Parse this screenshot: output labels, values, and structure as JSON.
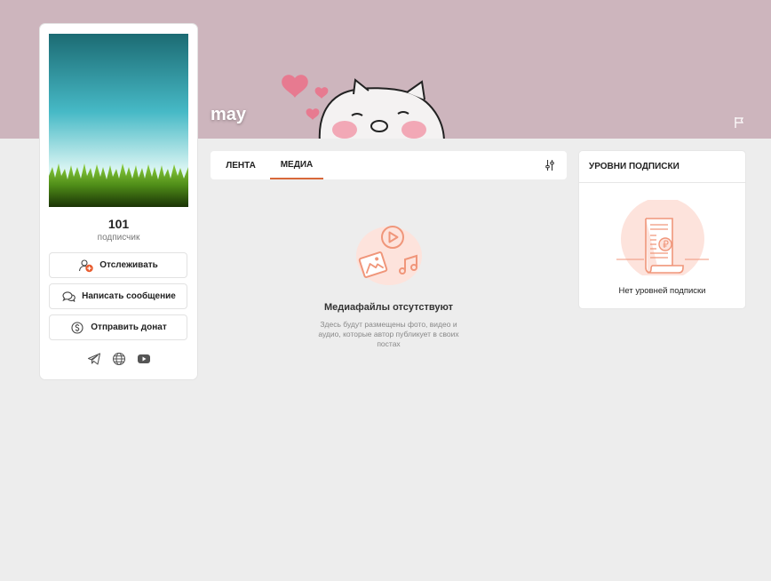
{
  "profile": {
    "name": "may"
  },
  "stats": {
    "count": "101",
    "label": "подписчик"
  },
  "actions": {
    "follow": "Отслеживать",
    "message": "Написать сообщение",
    "donate": "Отправить донат"
  },
  "socials": [
    "telegram-icon",
    "globe-icon",
    "youtube-icon"
  ],
  "tabs": [
    {
      "label": "ЛЕНТА",
      "active": false
    },
    {
      "label": "МЕДИА",
      "active": true
    }
  ],
  "empty_media": {
    "title": "Медиафайлы отсутствуют",
    "description": "Здесь будут размещены фото, видео и аудио, которые автор публикует в своих постах"
  },
  "subscription": {
    "title": "УРОВНИ ПОДПИСКИ",
    "empty": "Нет уровней подписки"
  },
  "colors": {
    "accent": "#d8683a",
    "cover": "#cdb5bd",
    "illustration": "#f0967a",
    "illustration_bg": "#fde3dc"
  }
}
